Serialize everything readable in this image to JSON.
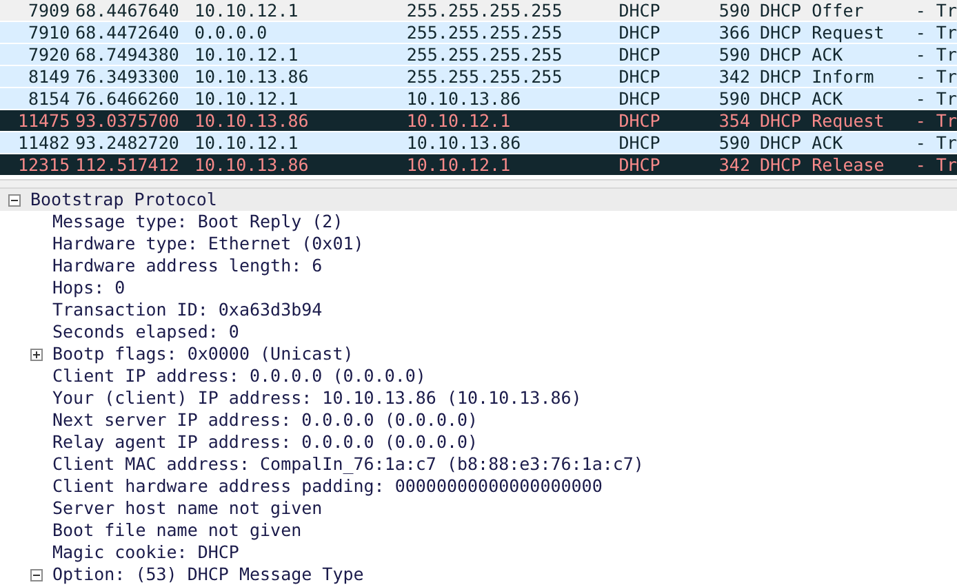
{
  "packet_list": {
    "rows": [
      {
        "kind": "plain",
        "no": "7909",
        "time": "68.4467640",
        "source": "10.10.12.1",
        "destination": "255.255.255.255",
        "protocol": "DHCP",
        "length": "590",
        "info": "DHCP Offer     - Tr"
      },
      {
        "kind": "dhcp",
        "no": "7910",
        "time": "68.4472640",
        "source": "0.0.0.0",
        "destination": "255.255.255.255",
        "protocol": "DHCP",
        "length": "366",
        "info": "DHCP Request   - Tr"
      },
      {
        "kind": "dhcp",
        "no": "7920",
        "time": "68.7494380",
        "source": "10.10.12.1",
        "destination": "255.255.255.255",
        "protocol": "DHCP",
        "length": "590",
        "info": "DHCP ACK       - Tr"
      },
      {
        "kind": "dhcp",
        "no": "8149",
        "time": "76.3493300",
        "source": "10.10.13.86",
        "destination": "255.255.255.255",
        "protocol": "DHCP",
        "length": "342",
        "info": "DHCP Inform    - Tr"
      },
      {
        "kind": "dhcp",
        "no": "8154",
        "time": "76.6466260",
        "source": "10.10.12.1",
        "destination": "10.10.13.86",
        "protocol": "DHCP",
        "length": "590",
        "info": "DHCP ACK       - Tr"
      },
      {
        "kind": "alert",
        "no": "11475",
        "time": "93.0375700",
        "source": "10.10.13.86",
        "destination": "10.10.12.1",
        "protocol": "DHCP",
        "length": "354",
        "info": "DHCP Request   - Tr"
      },
      {
        "kind": "dhcp",
        "no": "11482",
        "time": "93.2482720",
        "source": "10.10.12.1",
        "destination": "10.10.13.86",
        "protocol": "DHCP",
        "length": "590",
        "info": "DHCP ACK       - Tr"
      },
      {
        "kind": "alert",
        "no": "12315",
        "time": "112.517412",
        "source": "10.10.13.86",
        "destination": "10.10.12.1",
        "protocol": "DHCP",
        "length": "342",
        "info": "DHCP Release   - Tr"
      }
    ]
  },
  "details": {
    "tree": [
      {
        "label": "Bootstrap Protocol",
        "expanded": true,
        "children": [
          {
            "label": "Message type: Boot Reply (2)"
          },
          {
            "label": "Hardware type: Ethernet (0x01)"
          },
          {
            "label": "Hardware address length: 6"
          },
          {
            "label": "Hops: 0"
          },
          {
            "label": "Transaction ID: 0xa63d3b94"
          },
          {
            "label": "Seconds elapsed: 0"
          },
          {
            "label": "Bootp flags: 0x0000 (Unicast)",
            "expanded": false
          },
          {
            "label": "Client IP address: 0.0.0.0 (0.0.0.0)"
          },
          {
            "label": "Your (client) IP address: 10.10.13.86 (10.10.13.86)"
          },
          {
            "label": "Next server IP address: 0.0.0.0 (0.0.0.0)"
          },
          {
            "label": "Relay agent IP address: 0.0.0.0 (0.0.0.0)"
          },
          {
            "label": "Client MAC address: CompalIn_76:1a:c7 (b8:88:e3:76:1a:c7)"
          },
          {
            "label": "Client hardware address padding: 00000000000000000000"
          },
          {
            "label": "Server host name not given"
          },
          {
            "label": "Boot file name not given"
          },
          {
            "label": "Magic cookie: DHCP"
          },
          {
            "label": "Option: (53) DHCP Message Type",
            "expanded": true
          }
        ]
      }
    ]
  }
}
